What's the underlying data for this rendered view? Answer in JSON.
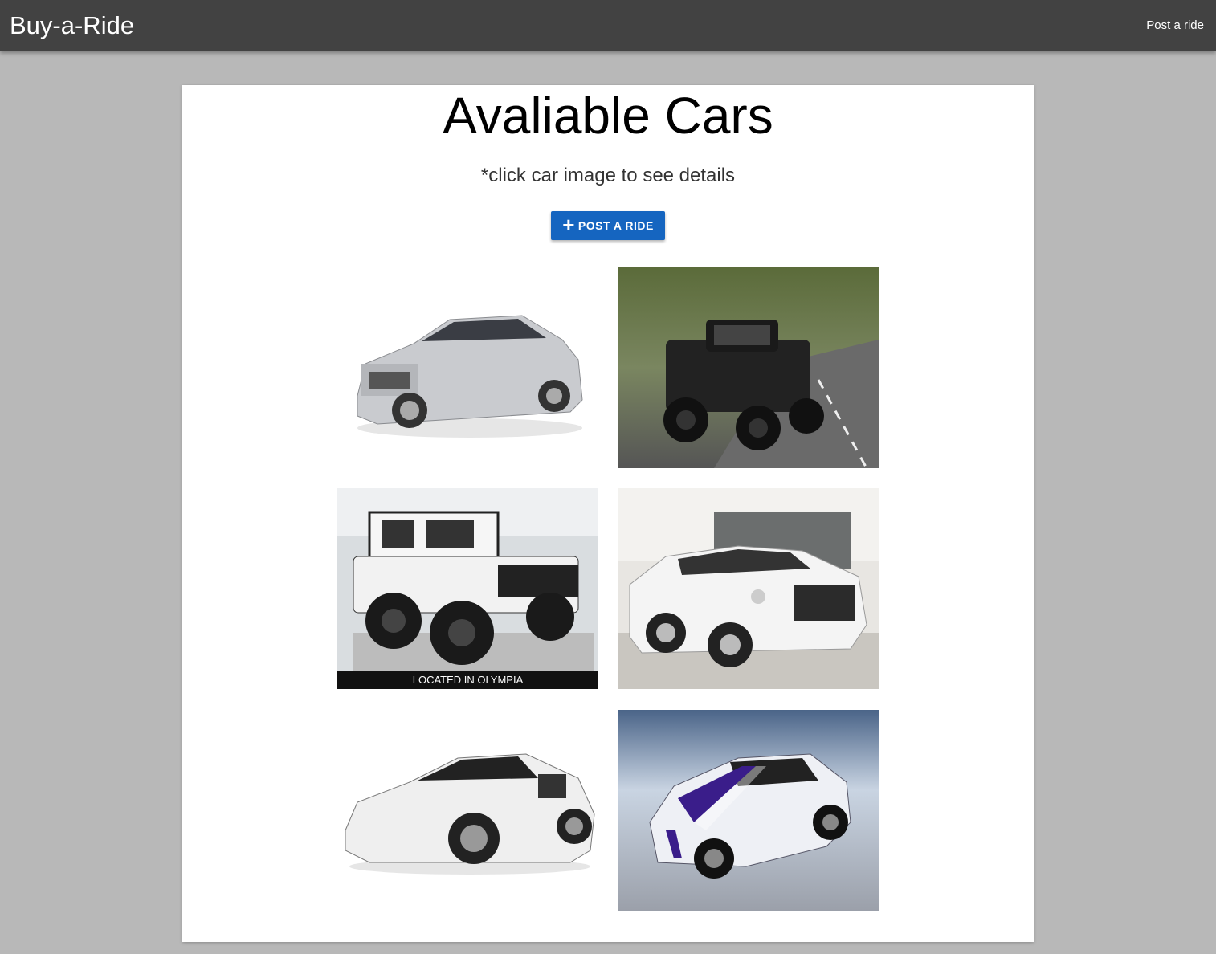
{
  "navbar": {
    "brand": "Buy-a-Ride",
    "link": "Post a ride"
  },
  "main": {
    "title": "Avaliable Cars",
    "subtitle": "*click car image to see details",
    "post_button": {
      "label": "POST A RIDE",
      "icon": "plus-icon"
    },
    "cars": [
      {
        "description": "silver sedan",
        "color": "#c9cbcf",
        "background": "#ffffff"
      },
      {
        "description": "black pickup truck on road",
        "color": "#222222",
        "background": "#6f7a5a"
      },
      {
        "description": "white jeep in showroom",
        "color": "#f2f2f2",
        "background": "#d9dde0",
        "overlay_text": "LOCATED IN OLYMPIA"
      },
      {
        "description": "white luxury sedan",
        "color": "#f4f4f4",
        "background": "#c9c6c0"
      },
      {
        "description": "white sports car",
        "color": "#efefef",
        "background": "#ffffff"
      },
      {
        "description": "white muscle car with stripes",
        "color": "#eef0f5",
        "background": "#8a96a8",
        "stripe": "#3a1d8a"
      }
    ]
  },
  "colors": {
    "navbar": "#424242",
    "page_background": "#b8b8b8",
    "button": "#1565c0"
  }
}
